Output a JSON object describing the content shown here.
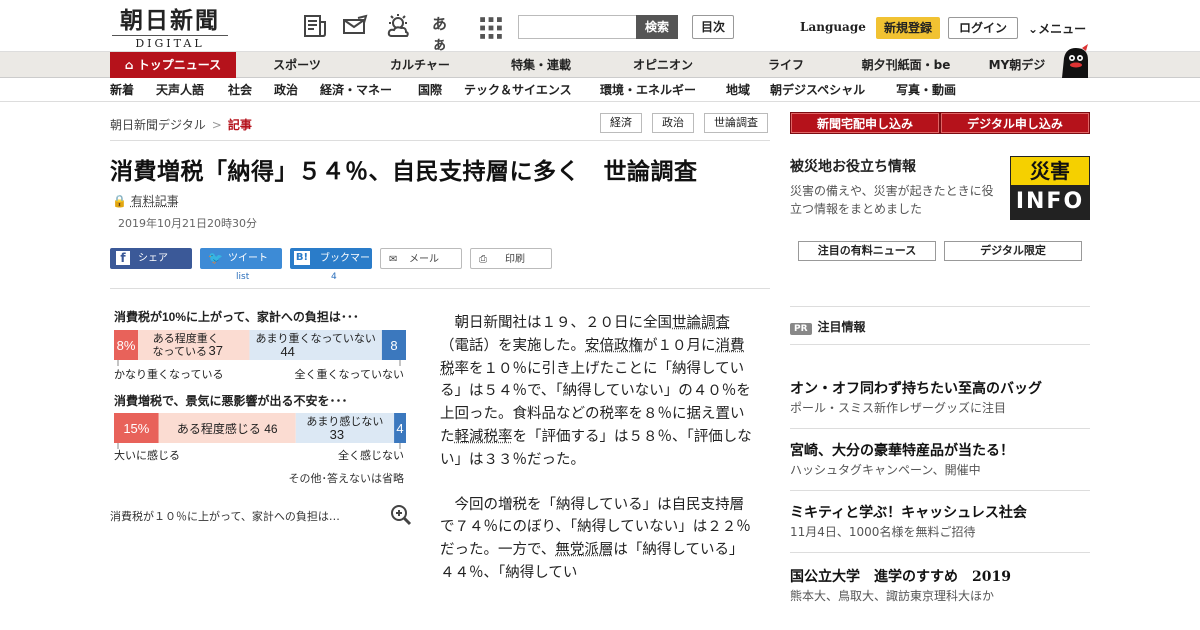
{
  "header": {
    "logo_main": "朝日新聞",
    "logo_sub": "DIGITAL",
    "search_button": "検索",
    "contents_button": "目次",
    "language": "Language",
    "signup": "新規登録",
    "login": "ログイン",
    "menu": "メニュー",
    "icons": [
      "news-icon",
      "mail-icon",
      "weather-icon",
      "font-size-icon",
      "grid-icon"
    ],
    "font_size_glyph": "あぁ"
  },
  "nav_primary": [
    "トップニュース",
    "スポーツ",
    "カルチャー",
    "特集・連載",
    "オピニオン",
    "ライフ",
    "朝夕刊紙面・be",
    "MY朝デジ"
  ],
  "nav_secondary": [
    "新着",
    "天声人語",
    "社会",
    "政治",
    "経済・マネー",
    "国際",
    "テック＆サイエンス",
    "環境・エネルギー",
    "地域",
    "朝デジスペシャル",
    "写真・動画"
  ],
  "breadcrumb": {
    "home": "朝日新聞デジタル",
    "sep": ">",
    "current": "記事"
  },
  "tags": [
    "経済",
    "政治",
    "世論調査"
  ],
  "article": {
    "title": "消費増税「納得」５４％、自民支持層に多く　世論調査",
    "paid_label": "有料記事",
    "date": "2019年10月21日20時30分",
    "share_buttons": [
      "シェア",
      "ツイート",
      "ブックマーク",
      "メール",
      "印刷"
    ],
    "tweet_count": "list",
    "bookmark_count": "4",
    "image_caption": "消費税が１０％に上がって、家計への負担は…",
    "para1_a": "朝日新聞社は１９、２０日に全国",
    "kw_poll": "世論調査",
    "para1_b": "（電話）を実施した。",
    "kw_abe": "安倍政権",
    "para1_c": "が１０月に",
    "kw_tax": "消費税",
    "para1_d": "率を１０％に引き上げたことに「納得している」は５４％で、「納得していない」の４０％を上回った。食料品などの税率を８％に据え置いた",
    "kw_reduced": "軽減税率",
    "para1_e": "を「評価する」は５８％、「評価しない」は３３％だった。",
    "para2_a": "今回の増税を「納得している」は自民支持層で７４％にのぼり、「納得していない」は２２％だった。一方で、",
    "kw_indep": "無党派層",
    "para2_b": "は「納得している」４４％、「納得してい"
  },
  "chart_data": [
    {
      "type": "bar",
      "title": "消費税が10%に上がって、家計への負担は･･･",
      "orientation": "horizontal-stacked",
      "series": [
        {
          "name": "かなり重くなっている",
          "value": 8,
          "label": "8%",
          "color": "#e8625a"
        },
        {
          "name": "ある程度重くなっている",
          "value": 37,
          "label": "37",
          "color": "#fbdcd2"
        },
        {
          "name": "あまり重くなっていない",
          "value": 44,
          "label": "44",
          "color": "#dce8f4"
        },
        {
          "name": "全く重くなっていない",
          "value": 8,
          "label": "8",
          "color": "#3b78be"
        }
      ]
    },
    {
      "type": "bar",
      "title": "消費増税で、景気に悪影響が出る不安を･･･",
      "orientation": "horizontal-stacked",
      "series": [
        {
          "name": "大いに感じる",
          "value": 15,
          "label": "15%",
          "color": "#e8625a"
        },
        {
          "name": "ある程度感じる",
          "value": 46,
          "label": "46",
          "color": "#fbdcd2"
        },
        {
          "name": "あまり感じない",
          "value": 33,
          "label": "33",
          "color": "#dce8f4"
        },
        {
          "name": "全く感じない",
          "value": 4,
          "label": "4",
          "color": "#3b78be"
        }
      ],
      "note": "その他･答えないは省略"
    }
  ],
  "sidebar": {
    "home_delivery": "新聞宅配申し込み",
    "digital_apply": "デジタル申し込み",
    "disaster_title": "被災地お役立ち情報",
    "disaster_desc": "災害の備えや、災害が起きたときに役立つ情報をまとめました",
    "disaster_badge_top": "災害",
    "disaster_badge_bottom": "INFO",
    "pill_paid": "注目の有料ニュース",
    "pill_digital": "デジタル限定",
    "pr_badge": "PR",
    "pr_label": "注目情報",
    "ads": [
      {
        "title": "オン・オフ同わず持ちたい至高のバッグ",
        "sub": "ポール・スミス新作レザーグッズに注目"
      },
      {
        "title": "宮崎、大分の豪華特産品が当たる！",
        "sub": "ハッシュタグキャンペーン、開催中"
      },
      {
        "title": "ミキティと学ぶ！キャッシュレス社会",
        "sub": "11月4日、1000名様を無料ご招待"
      },
      {
        "title": "国公立大学　進学のすすめ　2019",
        "sub": "熊本大、鳥取大、諏訪東京理科大ほか"
      }
    ]
  }
}
